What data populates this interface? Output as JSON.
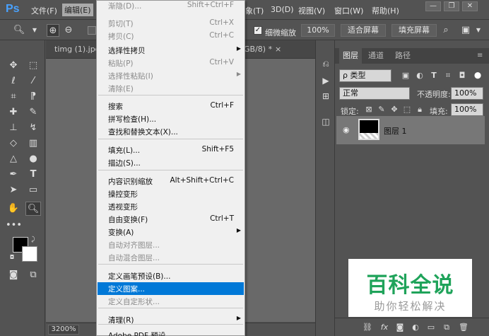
{
  "app": {
    "logo": "Ps"
  },
  "menubar": {
    "file": "文件(F)",
    "edit": "编辑(E)",
    "image_partial": "象(T)",
    "3d": "3D(D)",
    "view": "视图(V)",
    "window": "窗口(W)",
    "help": "帮助(H)"
  },
  "window_controls": {
    "minimize": "—",
    "restore": "❐",
    "close": "✕"
  },
  "options_bar": {
    "scrubby_zoom_checked": "✓",
    "scrubby_zoom": "细微缩放",
    "zoom_100": "100%",
    "fit_screen": "适合屏幕",
    "fill_screen": "填充屏幕"
  },
  "document": {
    "tab1": "timg (1).jpg",
    "tab2_partial": "GB/8) *",
    "tab_close": "×",
    "zoom": "3200%"
  },
  "edit_menu": {
    "items": [
      {
        "label": "渐隐(D)...",
        "shortcut": "Shift+Ctrl+F",
        "disabled": true
      },
      {
        "label": "剪切(T)",
        "shortcut": "Ctrl+X",
        "disabled": true
      },
      {
        "label": "拷贝(C)",
        "shortcut": "Ctrl+C",
        "disabled": true
      },
      {
        "label": "选择性拷贝",
        "shortcut": "",
        "arrow": "▶",
        "disabled": false
      },
      {
        "label": "粘贴(P)",
        "shortcut": "Ctrl+V",
        "disabled": true
      },
      {
        "label": "选择性粘贴(I)",
        "shortcut": "",
        "arrow": "▶",
        "disabled": true
      },
      {
        "label": "清除(E)",
        "shortcut": "",
        "disabled": true
      },
      {
        "label": "搜索",
        "shortcut": "Ctrl+F",
        "disabled": false
      },
      {
        "label": "拼写检查(H)...",
        "shortcut": "",
        "disabled": false
      },
      {
        "label": "查找和替换文本(X)...",
        "shortcut": "",
        "disabled": false
      },
      {
        "label": "填充(L)...",
        "shortcut": "Shift+F5",
        "disabled": false
      },
      {
        "label": "描边(S)...",
        "shortcut": "",
        "disabled": false
      },
      {
        "label": "内容识别缩放",
        "shortcut": "Alt+Shift+Ctrl+C",
        "disabled": false
      },
      {
        "label": "操控变形",
        "shortcut": "",
        "disabled": false
      },
      {
        "label": "透视变形",
        "shortcut": "",
        "disabled": false
      },
      {
        "label": "自由变换(F)",
        "shortcut": "Ctrl+T",
        "disabled": false
      },
      {
        "label": "变换(A)",
        "shortcut": "",
        "arrow": "▶",
        "disabled": false
      },
      {
        "label": "自动对齐图层...",
        "shortcut": "",
        "disabled": true
      },
      {
        "label": "自动混合图层...",
        "shortcut": "",
        "disabled": true
      },
      {
        "label": "定义画笔预设(B)...",
        "shortcut": "",
        "disabled": false
      },
      {
        "label": "定义图案...",
        "shortcut": "",
        "disabled": false,
        "highlighted": true
      },
      {
        "label": "定义自定形状...",
        "shortcut": "",
        "disabled": true
      },
      {
        "label": "清理(R)",
        "shortcut": "",
        "arrow": "▶",
        "disabled": false
      },
      {
        "label": "Adobe PDF 预设...",
        "shortcut": "",
        "disabled": false
      }
    ]
  },
  "layers_panel": {
    "tabs": [
      "图层",
      "通道",
      "路径"
    ],
    "kind_filter": "ρ 类型",
    "blend_mode": "正常",
    "opacity_label": "不透明度:",
    "opacity_value": "100%",
    "lock_label": "锁定:",
    "fill_label": "填充:",
    "fill_value": "100%",
    "layer_name": "图层 1",
    "footer_fx": "fx"
  },
  "watermark": {
    "main": "百科全说",
    "sub": "助你轻松解决"
  },
  "colors": {
    "accent_highlight": "#0078d7",
    "watermark_green": "#1fa35a",
    "ps_blue": "#49a2ff"
  }
}
